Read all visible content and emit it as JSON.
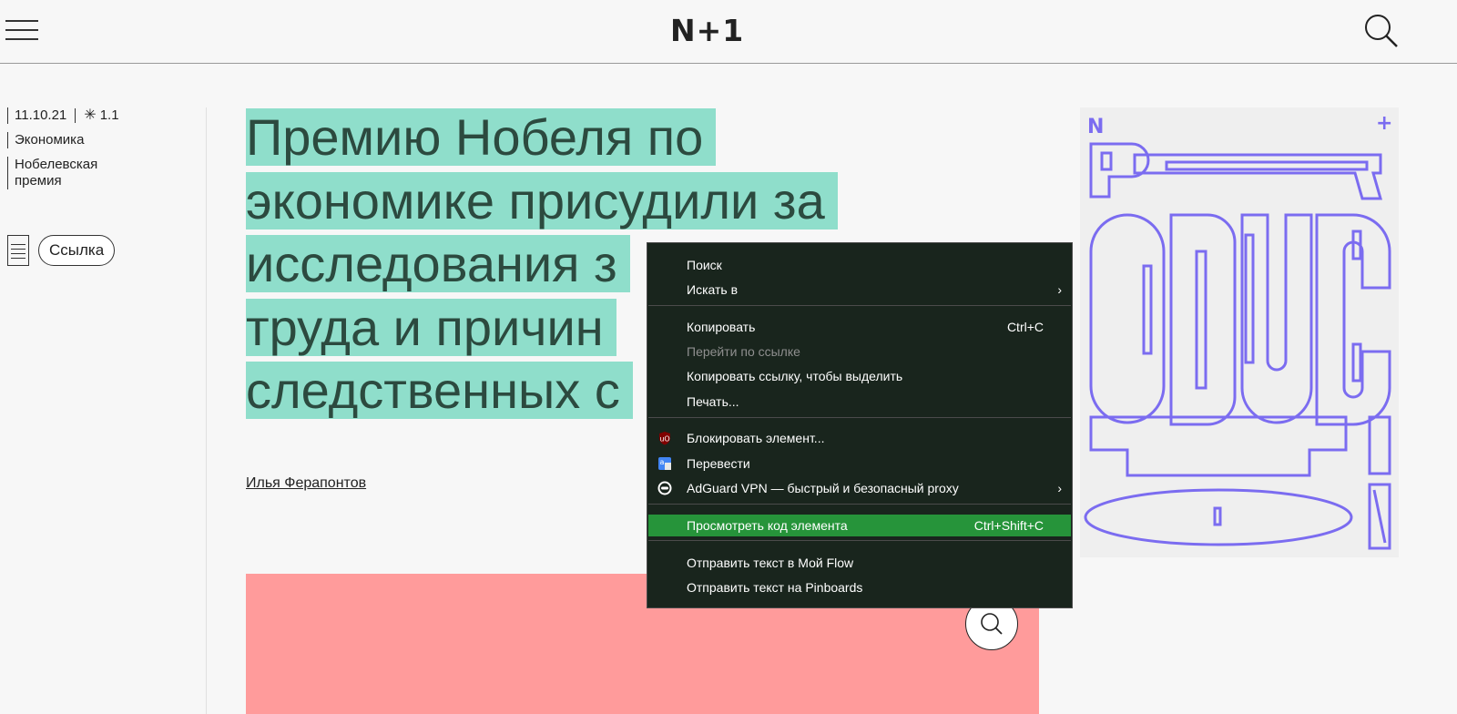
{
  "header": {
    "logo": "N+1"
  },
  "meta": {
    "date": "11.10.21",
    "difficulty": "1.1",
    "rubric": "Экономика",
    "tag": "Нобелевская премия",
    "link_button": "Ссылка"
  },
  "article": {
    "title_lines": [
      "Премию Нобеля по",
      "экономике присудили за",
      "исследования з",
      "труда и причин",
      "следственных с"
    ],
    "author": "Илья Ферапонтов"
  },
  "poster": {
    "letters": "PRODUCTION",
    "brand": "N+"
  },
  "context_menu": {
    "items": [
      {
        "label": "Поиск"
      },
      {
        "label": "Искать в",
        "submenu": true
      },
      {
        "label": "Копировать",
        "shortcut": "Ctrl+C"
      },
      {
        "label": "Перейти по ссылке",
        "disabled": true
      },
      {
        "label": "Копировать ссылку, чтобы выделить"
      },
      {
        "label": "Печать..."
      },
      {
        "label": "Блокировать элемент...",
        "icon": "ublock-icon"
      },
      {
        "label": "Перевести",
        "icon": "translate-icon"
      },
      {
        "label": "AdGuard VPN — быстрый и безопасный proxy",
        "icon": "adguard-icon",
        "submenu": true
      },
      {
        "label": "Просмотреть код элемента",
        "shortcut": "Ctrl+Shift+C",
        "highlighted": true
      },
      {
        "label": "Отправить текст в Мой Flow"
      },
      {
        "label": "Отправить текст на Pinboards"
      }
    ]
  },
  "colors": {
    "title_highlight": "#8fdecb",
    "title_text": "#2c4a3f",
    "pink_block": "#ff9b9b",
    "poster_stroke": "#7b6cf0",
    "menu_bg": "#19251d",
    "menu_highlight": "#26943a"
  }
}
